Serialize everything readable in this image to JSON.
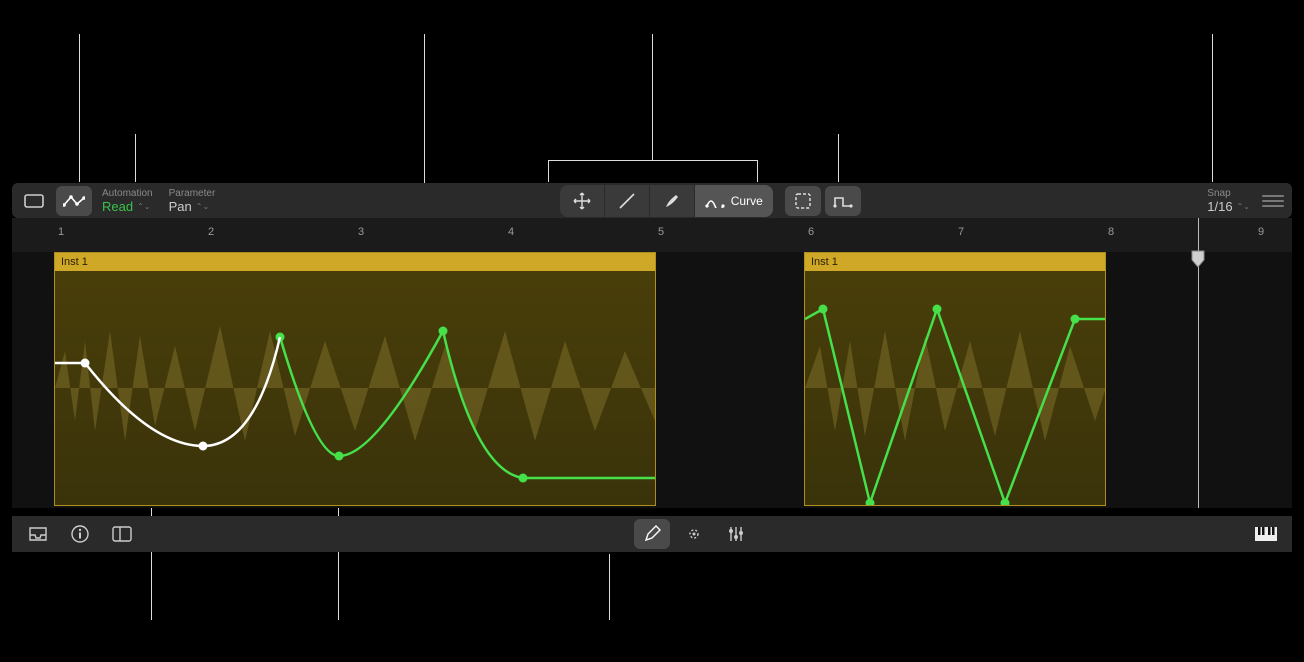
{
  "toolbar": {
    "automation_label": "Automation",
    "automation_mode": "Read",
    "parameter_label": "Parameter",
    "parameter_value": "Pan",
    "curve_label": "Curve",
    "snap_label": "Snap",
    "snap_value": "1/16"
  },
  "ruler": {
    "bars": [
      "1",
      "2",
      "3",
      "4",
      "5",
      "6",
      "7",
      "8",
      "9"
    ]
  },
  "regions": [
    {
      "name": "Inst 1"
    },
    {
      "name": "Inst 1"
    }
  ],
  "icons": {
    "marquee": "marquee",
    "automation": "automation",
    "move": "move",
    "line": "line",
    "brush": "brush",
    "curve": "curve",
    "select_area": "select-area",
    "step": "step",
    "inbox": "inbox",
    "info": "info",
    "sidebar": "sidebar",
    "pencil": "pencil",
    "focus": "focus",
    "mixer": "mixer",
    "piano": "piano"
  }
}
